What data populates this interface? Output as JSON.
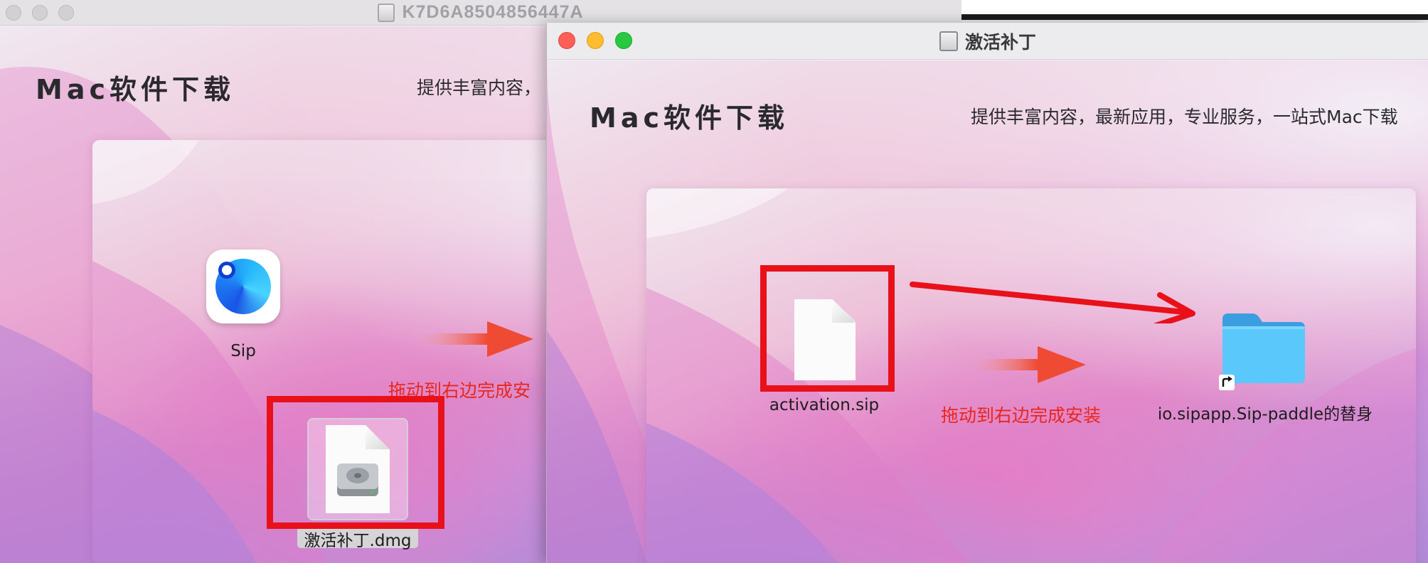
{
  "background_window": {
    "title": "K7D6A8504856447A",
    "brand": "Mac软件下载",
    "tagline": "提供丰富内容，",
    "hint": "拖动到右边完成安",
    "app_icon_label": "Sip",
    "dmg_label": "激活补丁.dmg"
  },
  "front_window": {
    "title": "激活补丁",
    "brand": "Mac软件下载",
    "tagline": "提供丰富内容，最新应用，专业服务，一站式Mac下载",
    "hint": "拖动到右边完成安装",
    "file_label": "activation.sip",
    "folder_label": "io.sipapp.Sip-paddle的替身"
  },
  "colors": {
    "annotation_red": "#e8111a",
    "hint_text": "#e8271b",
    "folder_blue": "#5ac8fa",
    "close": "#ff5f57",
    "minimize": "#febc2e",
    "maximize": "#28c840"
  },
  "icons": [
    "disk-icon",
    "sip-app-icon",
    "dmg-disk-image-icon",
    "document-icon",
    "folder-alias-icon",
    "alias-arrow-icon",
    "drag-arrow-icon"
  ]
}
